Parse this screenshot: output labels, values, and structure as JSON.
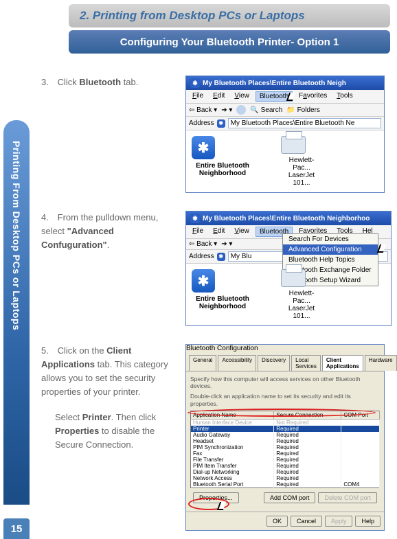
{
  "title_main": "2. Printing from Desktop PCs or Laptops",
  "title_sub": "Configuring Your Bluetooth Printer- Option  1",
  "side_tab": "Printing From Desktop PCs or Laptops",
  "page_number": "15",
  "step3": {
    "num": "3.",
    "text_a": "Click ",
    "bold": "Bluetooth",
    "text_b": " tab."
  },
  "step4": {
    "num": "4.",
    "text_a": "From the pulldown menu, select ",
    "bold": "\"Advanced Confuguration\"",
    "text_b": "."
  },
  "step5": {
    "num": "5.",
    "text_a": "Click on the ",
    "bold_a": "Client Applications",
    "text_b": " tab. This category allows you to set the security properties of your printer.",
    "sub_a": "Select ",
    "bold_b": "Printer",
    "sub_b": ". Then click ",
    "bold_c": "Properties",
    "sub_c": " to disable the Secure Connection."
  },
  "shot1": {
    "title": "My Bluetooth Places\\Entire Bluetooth Neigh",
    "menu": {
      "file": "File",
      "edit": "Edit",
      "view": "View",
      "bluetooth": "Bluetooth",
      "favorites": "Favorites",
      "tools": "Tools"
    },
    "toolbar": {
      "back": "Back",
      "search": "Search",
      "folders": "Folders"
    },
    "address_label": "Address",
    "address_value": "My Bluetooth Places\\Entire Bluetooth Ne",
    "icon_label": "Entire Bluetooth Neighborhood",
    "printer_label": "Hewlett-Pac... LaserJet 101..."
  },
  "shot2": {
    "title": "My Bluetooth Places\\Entire Bluetooth Neighborhoo",
    "menu": {
      "file": "File",
      "edit": "Edit",
      "view": "View",
      "bluetooth": "Bluetooth",
      "favorites": "Favorites",
      "tools": "Tools",
      "help": "Hel"
    },
    "toolbar": {
      "back": "Back"
    },
    "address_label": "Address",
    "address_short": "My Blu",
    "dropdown": {
      "item1": "Search For Devices",
      "item2": "Advanced Configuration",
      "item3": "Bluetooth Help Topics",
      "item4": "Bluetooth Exchange Folder",
      "item5": "Bluetooth Setup Wizard"
    },
    "icon_label": "Entire Bluetooth Neighborhood",
    "printer_label": "Hewlett-Pac... LaserJet 101..."
  },
  "shot3": {
    "title": "Bluetooth Configuration",
    "tabs": {
      "general": "General",
      "accessibility": "Accessibility",
      "discovery": "Discovery",
      "local": "Local Services",
      "client": "Client Applications",
      "hardware": "Hardware"
    },
    "desc1": "Specify how this computer will access services on other Bluetooth devices.",
    "desc2": "Double-click an application name to set its security and edit its properties.",
    "cols": {
      "c1": "Application Name",
      "c2": "Secure Connection",
      "c3": "COM Port"
    },
    "rows": [
      {
        "a": "Human Interface Device",
        "b": "Not Required",
        "c": ""
      },
      {
        "a": "Printer",
        "b": "Required",
        "c": ""
      },
      {
        "a": "Audio Gateway",
        "b": "Required",
        "c": ""
      },
      {
        "a": "Headset",
        "b": "Required",
        "c": ""
      },
      {
        "a": "PIM Synchronization",
        "b": "Required",
        "c": ""
      },
      {
        "a": "Fax",
        "b": "Required",
        "c": ""
      },
      {
        "a": "File Transfer",
        "b": "Required",
        "c": ""
      },
      {
        "a": "PIM Item Transfer",
        "b": "Required",
        "c": ""
      },
      {
        "a": "Dial-up Networking",
        "b": "Required",
        "c": ""
      },
      {
        "a": "Network Access",
        "b": "Required",
        "c": ""
      },
      {
        "a": "Bluetooth Serial Port",
        "b": "Required",
        "c": "COM4"
      }
    ],
    "btn_properties": "Properties...",
    "btn_addcom": "Add COM port",
    "btn_delcom": "Delete COM port",
    "btn_ok": "OK",
    "btn_cancel": "Cancel",
    "btn_apply": "Apply",
    "btn_help": "Help"
  }
}
